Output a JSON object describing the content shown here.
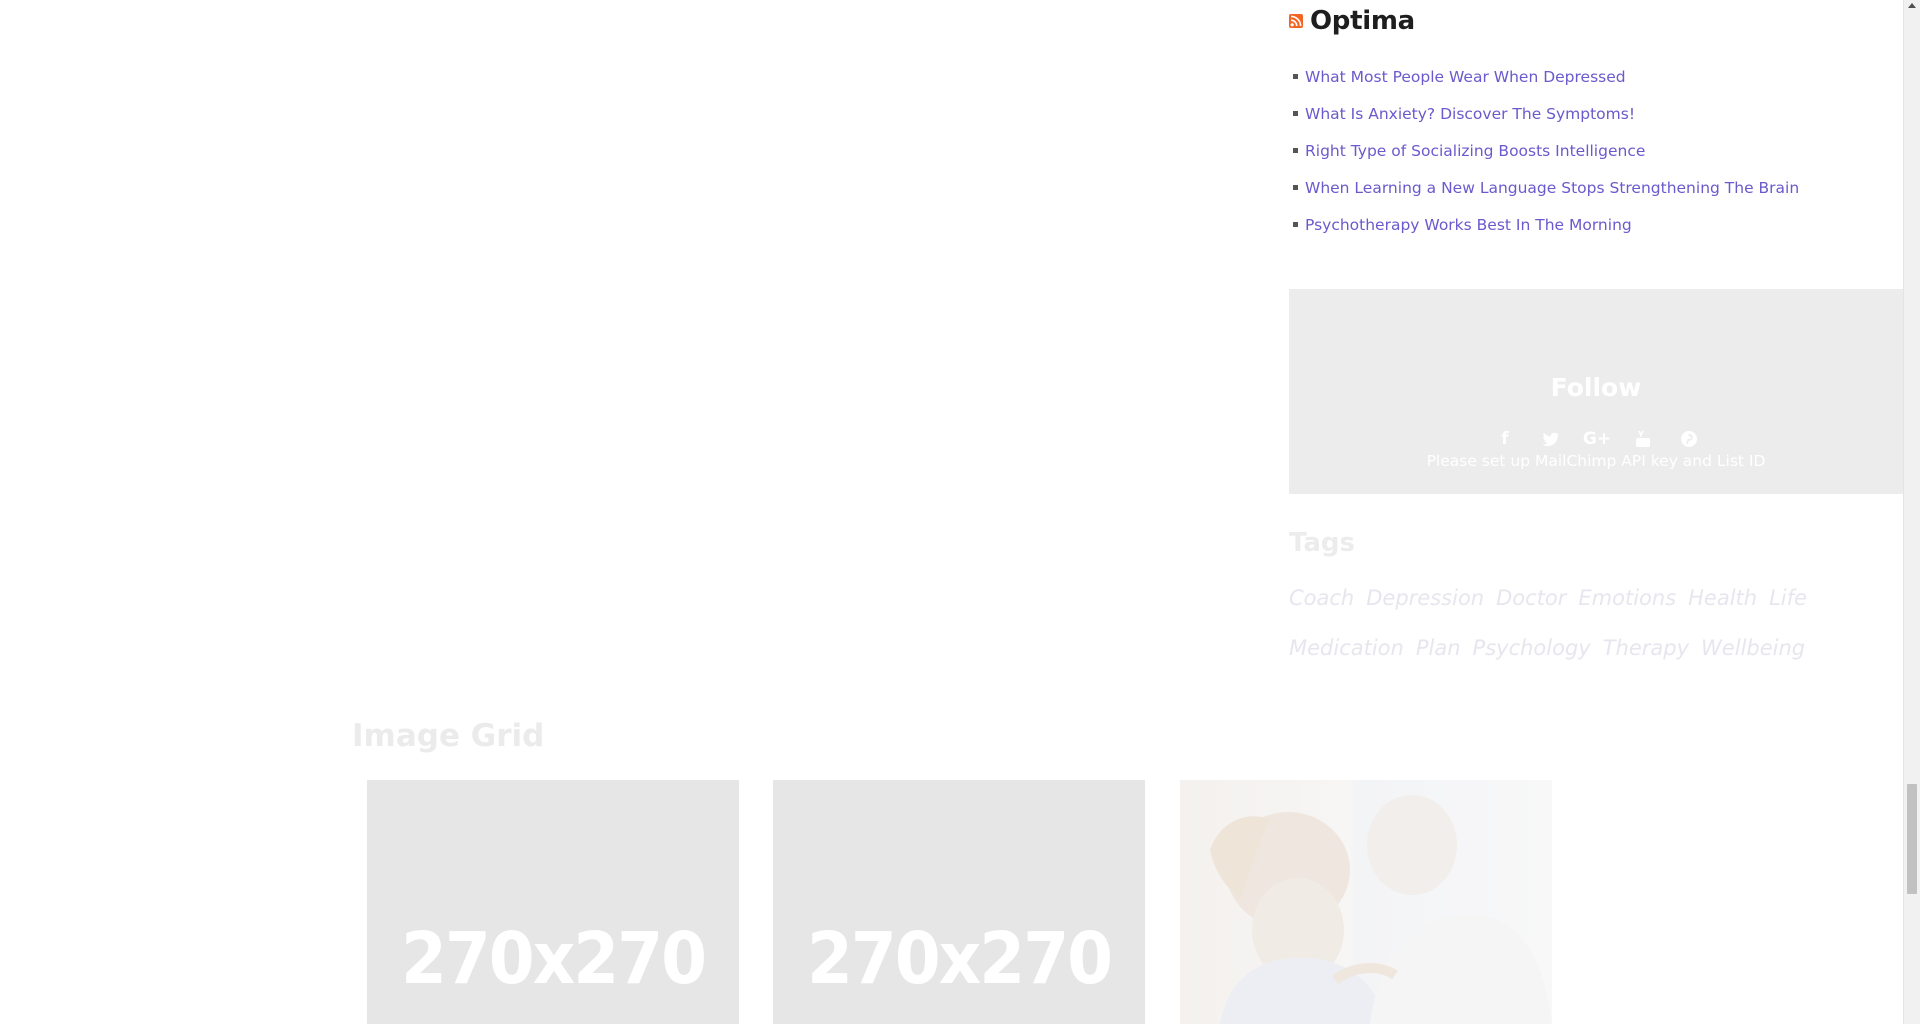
{
  "rss_widget": {
    "title": "Optima",
    "items": [
      {
        "label": "What Most People Wear When Depressed"
      },
      {
        "label": "What Is Anxiety? Discover The Symptoms!"
      },
      {
        "label": "Right Type of Socializing Boosts Intelligence"
      },
      {
        "label": "When Learning a New Language Stops Strengthening The Brain"
      },
      {
        "label": "Psychotherapy Works Best In The Morning"
      }
    ]
  },
  "follow_widget": {
    "title": "Follow",
    "social_icons": [
      "facebook-icon",
      "twitter-icon",
      "google-plus-icon",
      "youtube-icon",
      "pinterest-icon"
    ],
    "message": "Please set up MailChimp API key and List ID"
  },
  "tags_widget": {
    "title": "Tags",
    "tags": [
      "Coach",
      "Depression",
      "Doctor",
      "Emotions",
      "Health",
      "Life",
      "Medication",
      "Plan",
      "Psychology",
      "Therapy",
      "Wellbeing"
    ]
  },
  "image_grid": {
    "title": "Image Grid",
    "tiles": [
      {
        "placeholder_text": "270x270"
      },
      {
        "placeholder_text": "270x270"
      }
    ]
  },
  "colors": {
    "link": "#6a5acd",
    "rss_orange": "#f26522",
    "follow_bg": "#ececec"
  }
}
